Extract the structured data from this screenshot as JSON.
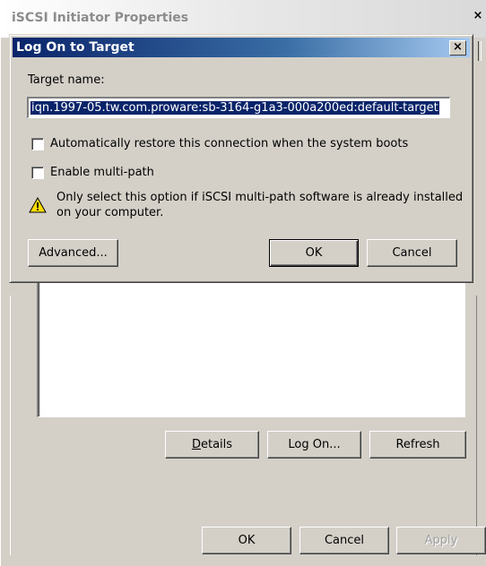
{
  "parent_window": {
    "title": "iSCSI Initiator Properties",
    "close_glyph": "×",
    "buttons": {
      "details": "Details",
      "log_on": "Log On...",
      "refresh": "Refresh",
      "ok": "OK",
      "cancel": "Cancel",
      "apply": "Apply"
    }
  },
  "dialog": {
    "title": "Log On to Target",
    "close_glyph": "×",
    "target_name_label": "Target name:",
    "target_name_value": "iqn.1997-05.tw.com.proware:sb-3164-g1a3-000a200ed:default-target",
    "auto_restore_label": "Automatically restore this connection when the system boots",
    "auto_restore_checked": false,
    "multipath_label": "Enable multi-path",
    "multipath_checked": false,
    "warning_text": "Only select this option if iSCSI multi-path software is already installed on your computer.",
    "warning_icon": "warning-icon",
    "buttons": {
      "advanced": "Advanced...",
      "ok": "OK",
      "cancel": "Cancel"
    }
  },
  "colors": {
    "title_active": "#0a246a",
    "dialog_face": "#d4d0c8",
    "selection": "#0a246a"
  }
}
